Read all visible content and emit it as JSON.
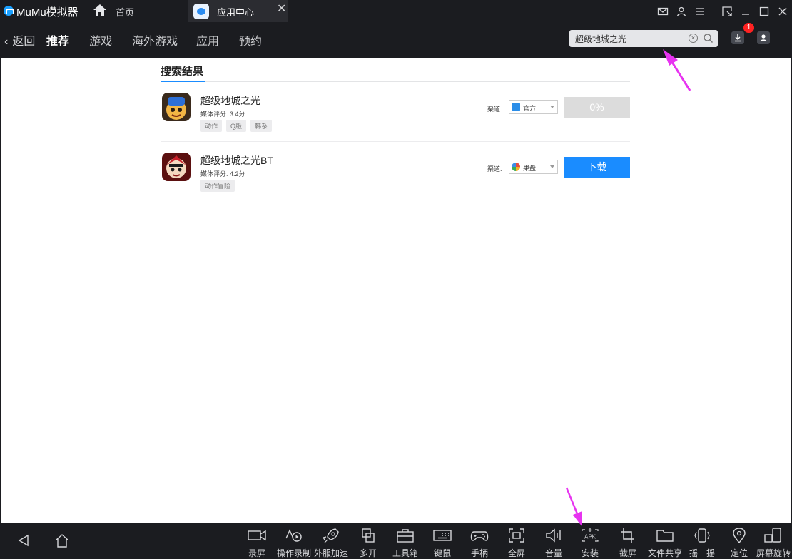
{
  "titlebar": {
    "app_title": "MuMu模拟器",
    "home_label": "首页",
    "active_tab_label": "应用中心",
    "close_glyph": "✕"
  },
  "navbar": {
    "back_label": "返回",
    "items": [
      "推荐",
      "游戏",
      "海外游戏",
      "应用",
      "预约"
    ],
    "active_index": 0,
    "search_value": "超级地城之光",
    "download_badge": "1"
  },
  "content": {
    "section_title": "搜索结果",
    "channel_label": "渠道:",
    "results": [
      {
        "name": "超级地城之光",
        "rating": "媒体评分: 3.4分",
        "tags": [
          "动作",
          "Q版",
          "韩系"
        ],
        "channel": "官方",
        "action": "0%",
        "action_state": "progress"
      },
      {
        "name": "超级地城之光BT",
        "rating": "媒体评分: 4.2分",
        "tags": [
          "动作冒险"
        ],
        "channel": "果盘",
        "action": "下载",
        "action_state": "download"
      }
    ]
  },
  "toolbar": {
    "tools": [
      "录屏",
      "操作录制",
      "外服加速",
      "多开",
      "工具箱",
      "键鼠",
      "手柄",
      "全屏",
      "音量",
      "安装",
      "截屏",
      "文件共享",
      "摇一摇",
      "定位",
      "屏幕旋转"
    ],
    "apk_glyph": "APK"
  },
  "colors": {
    "chrome": "#1b1c20",
    "accent": "#1a8cff",
    "annotation_arrow": "#e733f0"
  }
}
